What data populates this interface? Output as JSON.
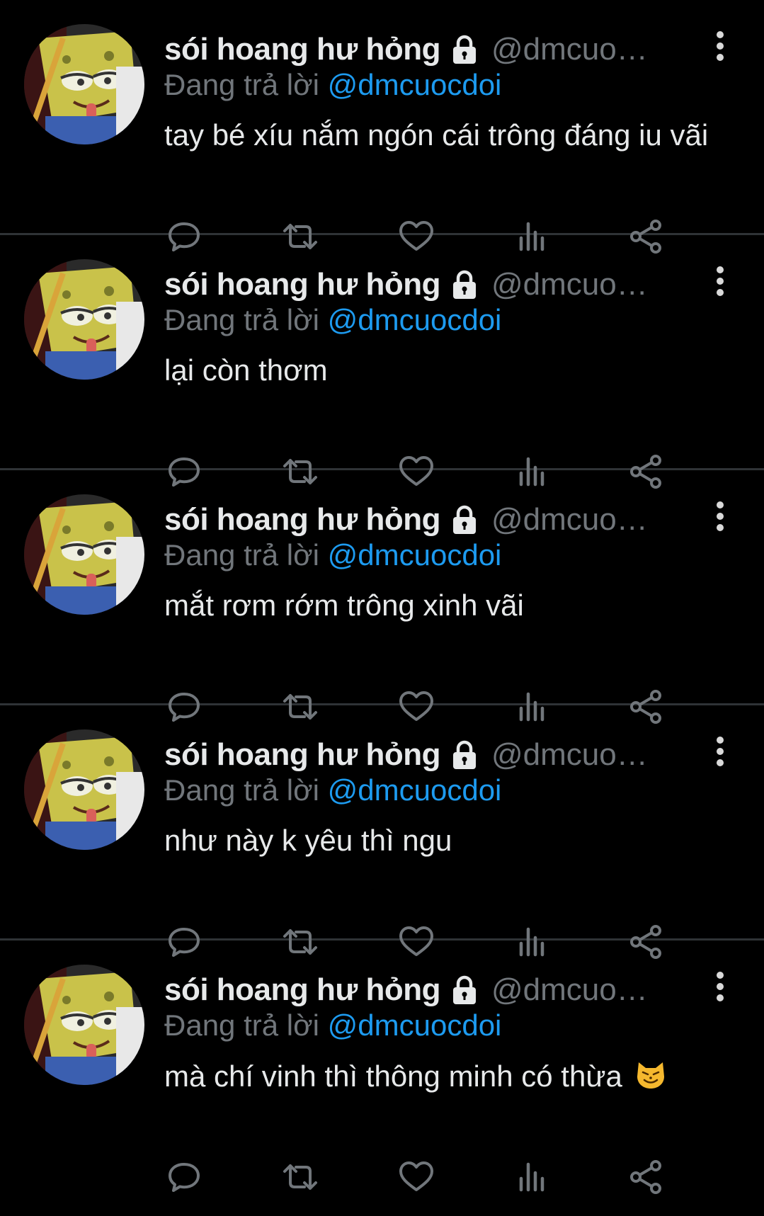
{
  "colors": {
    "background": "#000000",
    "divider": "#2f3336",
    "text_primary": "#e7e9ea",
    "text_secondary": "#71767b",
    "mention": "#1d9bf0"
  },
  "icons": {
    "protected": "lock-icon",
    "reply": "reply-icon",
    "retweet": "retweet-icon",
    "like": "like-icon",
    "views": "views-icon",
    "share": "share-icon",
    "more": "more-icon"
  },
  "tweets": [
    {
      "display_name": "sói hoang hư hỏng",
      "handle": "@dmcuocd...",
      "reply_prefix": "Đang trả lời",
      "reply_to": "@dmcuocdoi",
      "text": "tay bé xíu nắm ngón cái trông đáng iu vãi"
    },
    {
      "display_name": "sói hoang hư hỏng",
      "handle": "@dmcuocd...",
      "reply_prefix": "Đang trả lời",
      "reply_to": "@dmcuocdoi",
      "text": "lại còn thơm"
    },
    {
      "display_name": "sói hoang hư hỏng",
      "handle": "@dmcuocd...",
      "reply_prefix": "Đang trả lời",
      "reply_to": "@dmcuocdoi",
      "text": "mắt rơm rớm trông xinh vãi"
    },
    {
      "display_name": "sói hoang hư hỏng",
      "handle": "@dmcuocd...",
      "reply_prefix": "Đang trả lời",
      "reply_to": "@dmcuocdoi",
      "text": "như này k yêu thì ngu"
    },
    {
      "display_name": "sói hoang hư hỏng",
      "handle": "@dmcuocd...",
      "reply_prefix": "Đang trả lời",
      "reply_to": "@dmcuocdoi",
      "text": "mà chí vinh thì thông minh có thừa",
      "emoji": "cat-emoji-icon"
    }
  ]
}
